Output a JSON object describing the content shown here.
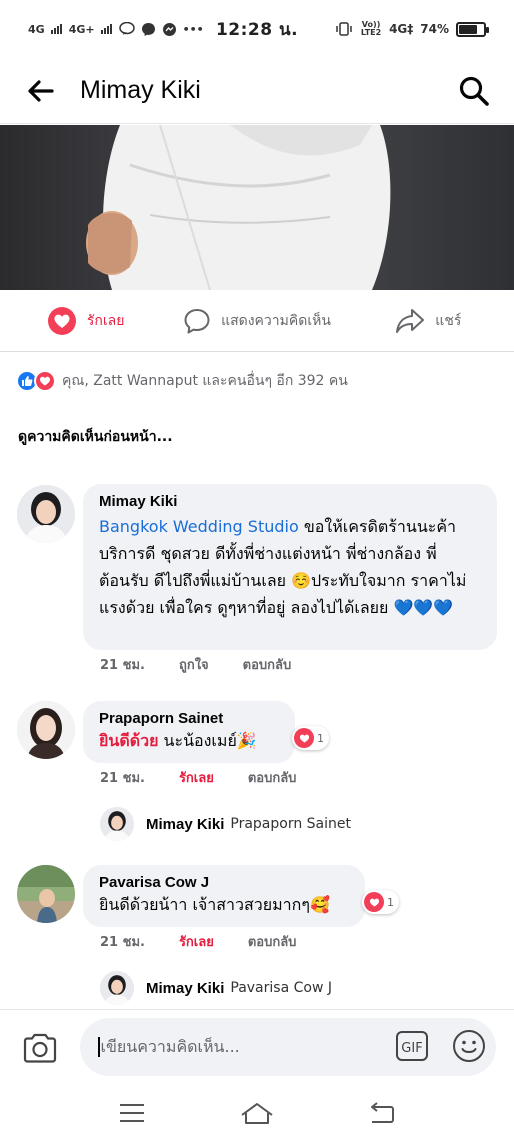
{
  "status_bar": {
    "network_left": [
      "4G",
      "4G+"
    ],
    "time": "12:28 น.",
    "network_right": "Vo)) LTE2",
    "signal": "4G‡",
    "battery": "74%",
    "battery_level": 0.74
  },
  "header": {
    "title": "Mimay Kiki"
  },
  "post_actions": {
    "love_label": "รักเลย",
    "comment_label": "แสดงความคิดเห็น",
    "share_label": "แชร์"
  },
  "reactions": {
    "summary": "คุณ, Zatt Wannaput และคนอื่นๆ อีก 392 คน"
  },
  "view_previous": "ดูความคิดเห็นก่อนหน้า...",
  "comments": [
    {
      "author": "Mimay Kiki",
      "link": "Bangkok Wedding Studio",
      "text": "ขอให้เครดิตร้านนะค้า บริการดี ชุดสวย ดีทั้งพี่ช่างแต่งหน้า พี่ช่างกล้อง พี่ต้อนรับ ดีไปถึงพี่แม่บ้านเลย ☺️ประทับใจมาก ราคาไม่แรงด้วย เพื่อใคร ดูๆหาที่อยู่ ลองไปได้เลยย 💙💙💙",
      "time": "21 ชม.",
      "react_label": "ถูกใจ",
      "reply_label": "ตอบกลับ"
    },
    {
      "author": "Prapaporn Sainet",
      "highlight": "ยินดีด้วย",
      "text": " นะน้องเมย์🎉",
      "time": "21 ชม.",
      "react_label": "รักเลย",
      "reply_label": "ตอบกลับ",
      "reaction_count": "1",
      "reply_preview": {
        "author": "Mimay Kiki",
        "text": "Prapaporn Sainet"
      }
    },
    {
      "author": "Pavarisa Cow J",
      "text": "ยินดีด้วยน้าา เจ้าสาวสวยมากๆ🥰",
      "time": "21 ชม.",
      "react_label": "รักเลย",
      "reply_label": "ตอบกลับ",
      "reaction_count": "1",
      "reply_preview": {
        "author": "Mimay Kiki",
        "text": "Pavarisa Cow J"
      }
    }
  ],
  "composer": {
    "placeholder": "เขียนความคิดเห็น...",
    "gif_label": "GIF"
  },
  "icons": {
    "back": "arrow-left-icon",
    "search": "magnifier-icon",
    "love": "heart-icon",
    "comment": "speech-bubble-icon",
    "share": "share-arrow-icon",
    "camera": "camera-icon",
    "gif": "gif-icon",
    "emoji": "smiley-icon"
  },
  "colors": {
    "love": "#e41e3f",
    "link": "#1a6ed8",
    "like_blue": "#1877f2",
    "bubble": "#f0f2f5",
    "meta_gray": "#65676b"
  }
}
